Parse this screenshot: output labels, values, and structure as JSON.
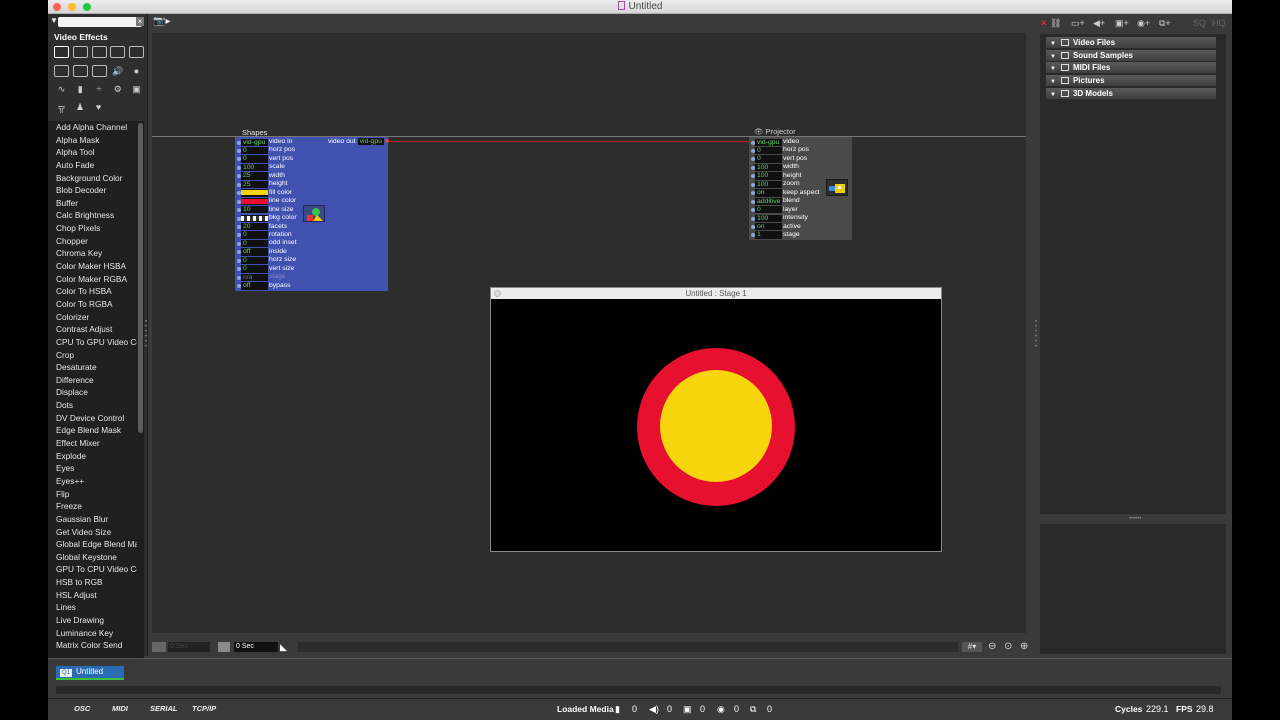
{
  "window": {
    "title": "Untitled"
  },
  "left_panel": {
    "search_placeholder": "",
    "title": "Video Effects",
    "effects": [
      "Add Alpha Channel",
      "Alpha Mask",
      "Alpha Tool",
      "Auto Fade",
      "Background Color",
      "Blob Decoder",
      "Buffer",
      "Calc Brightness",
      "Chop Pixels",
      "Chopper",
      "Chroma Key",
      "Color Maker HSBA",
      "Color Maker RGBA",
      "Color To HSBA",
      "Color To RGBA",
      "Colorizer",
      "Contrast Adjust",
      "CPU To GPU Video Cor",
      "Crop",
      "Desaturate",
      "Difference",
      "Displace",
      "Dots",
      "DV Device Control",
      "Edge Blend Mask",
      "Effect Mixer",
      "Explode",
      "Eyes",
      "Eyes++",
      "Flip",
      "Freeze",
      "Gaussian Blur",
      "Get Video Size",
      "Global Edge Blend Ma:",
      "Global Keystone",
      "GPU To CPU Video Cor",
      "HSB to RGB",
      "HSL Adjust",
      "Lines",
      "Live Drawing",
      "Luminance Key",
      "Matrix Color Send"
    ]
  },
  "shapes_actor": {
    "title": "Shapes",
    "output": {
      "label": "video out",
      "value": "vid-gpu"
    },
    "inputs": [
      {
        "value": "vid-gpu",
        "name": "video in"
      },
      {
        "value": "0",
        "name": "horz pos"
      },
      {
        "value": "0",
        "name": "vert pos"
      },
      {
        "value": "100",
        "name": "scale"
      },
      {
        "value": "25",
        "name": "width"
      },
      {
        "value": "25",
        "name": "height"
      },
      {
        "value": "",
        "name": "fill color",
        "swatch": "#f6d50c"
      },
      {
        "value": "",
        "name": "line color",
        "swatch": "#e8102f"
      },
      {
        "value": "10",
        "name": "line size"
      },
      {
        "value": "",
        "name": "bkg color",
        "swatch": "checker"
      },
      {
        "value": "20",
        "name": "facets"
      },
      {
        "value": "0",
        "name": "rotation"
      },
      {
        "value": "0",
        "name": "odd inset"
      },
      {
        "value": "off",
        "name": "inside"
      },
      {
        "value": "0",
        "name": "horz size"
      },
      {
        "value": "0",
        "name": "vert size"
      },
      {
        "value": "n/a",
        "name": "stage",
        "dim": true
      },
      {
        "value": "off",
        "name": "bypass"
      }
    ]
  },
  "projector_actor": {
    "title": "Projector",
    "inputs": [
      {
        "value": "vid-gpu",
        "name": "video"
      },
      {
        "value": "0",
        "name": "horz pos"
      },
      {
        "value": "0",
        "name": "vert pos"
      },
      {
        "value": "100",
        "name": "width"
      },
      {
        "value": "100",
        "name": "height"
      },
      {
        "value": "100",
        "name": "zoom"
      },
      {
        "value": "on",
        "name": "keep aspect"
      },
      {
        "value": "additive",
        "name": "blend"
      },
      {
        "value": "0",
        "name": "layer"
      },
      {
        "value": "100",
        "name": "intensity"
      },
      {
        "value": "on",
        "name": "active"
      },
      {
        "value": "1",
        "name": "stage"
      }
    ]
  },
  "stage_window": {
    "title": "Untitled : Stage 1",
    "ring_color": "#e8102f",
    "fill_color": "#f6d50c"
  },
  "media_panel": {
    "categories": [
      "Video Files",
      "Sound Samples",
      "MIDI Files",
      "Pictures",
      "3D Models"
    ]
  },
  "timeline": {
    "time_left": "0 Sec",
    "time_right": "0 Sec"
  },
  "scene": {
    "number": "Q1",
    "name": "Untitled"
  },
  "status": {
    "buttons": [
      "OSC",
      "MIDI",
      "SERIAL",
      "TCP/IP"
    ],
    "loaded_media_label": "Loaded Media",
    "counts": [
      "0",
      "0",
      "0",
      "0",
      "0"
    ],
    "cycles_label": "Cycles",
    "cycles_value": "229.1",
    "fps_label": "FPS",
    "fps_value": "29.8"
  }
}
